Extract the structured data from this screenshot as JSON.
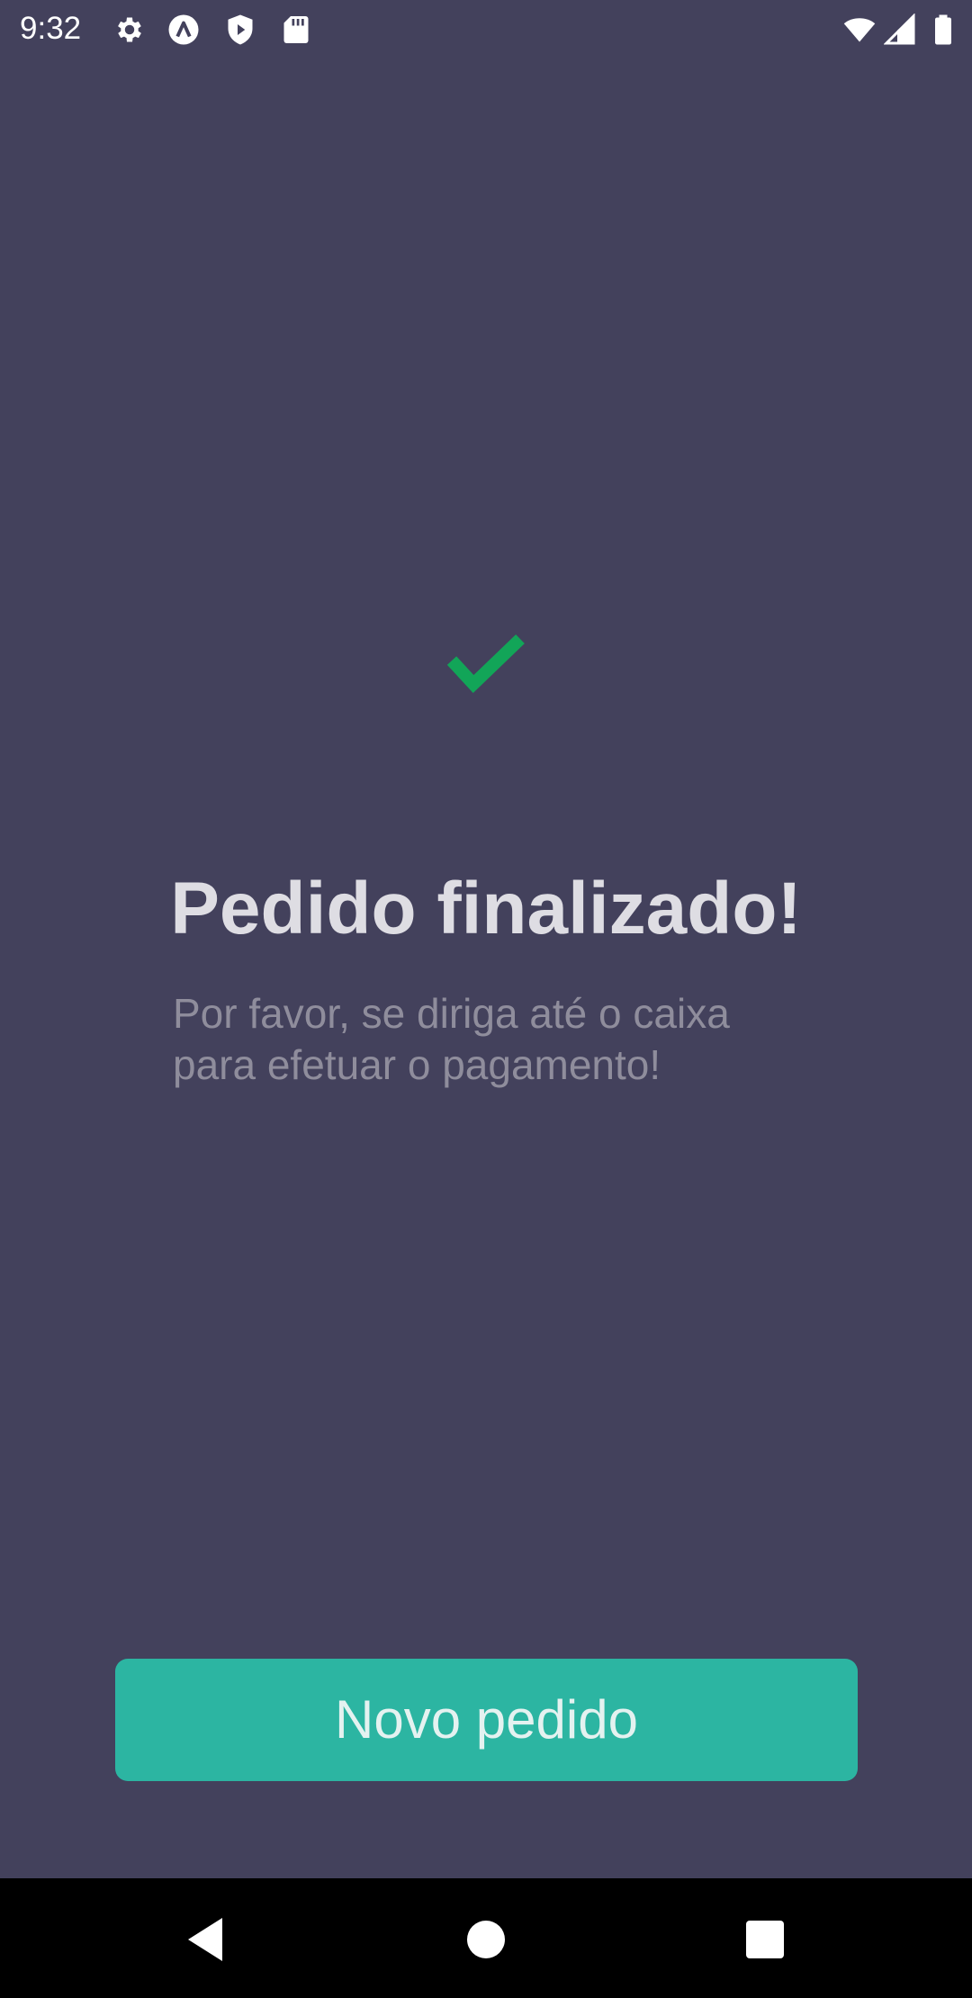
{
  "status_bar": {
    "time": "9:32",
    "left_icons": [
      "settings-gear-icon",
      "app-a-icon",
      "shield-play-icon",
      "sd-card-icon"
    ],
    "right_icons": [
      "wifi-icon",
      "cell-signal-icon",
      "battery-icon"
    ]
  },
  "main": {
    "status_icon": "checkmark-icon",
    "status_color": "#12a558",
    "title": "Pedido finalizado!",
    "subtitle_lines": [
      "Por favor, se diriga até o caixa",
      "para efetuar o pagamento!"
    ],
    "button_label": "Novo pedido",
    "button_color": "#2cb5a2",
    "background_color": "#43415c"
  },
  "nav_bar": {
    "buttons": [
      "back-icon",
      "home-icon",
      "recents-icon"
    ]
  }
}
